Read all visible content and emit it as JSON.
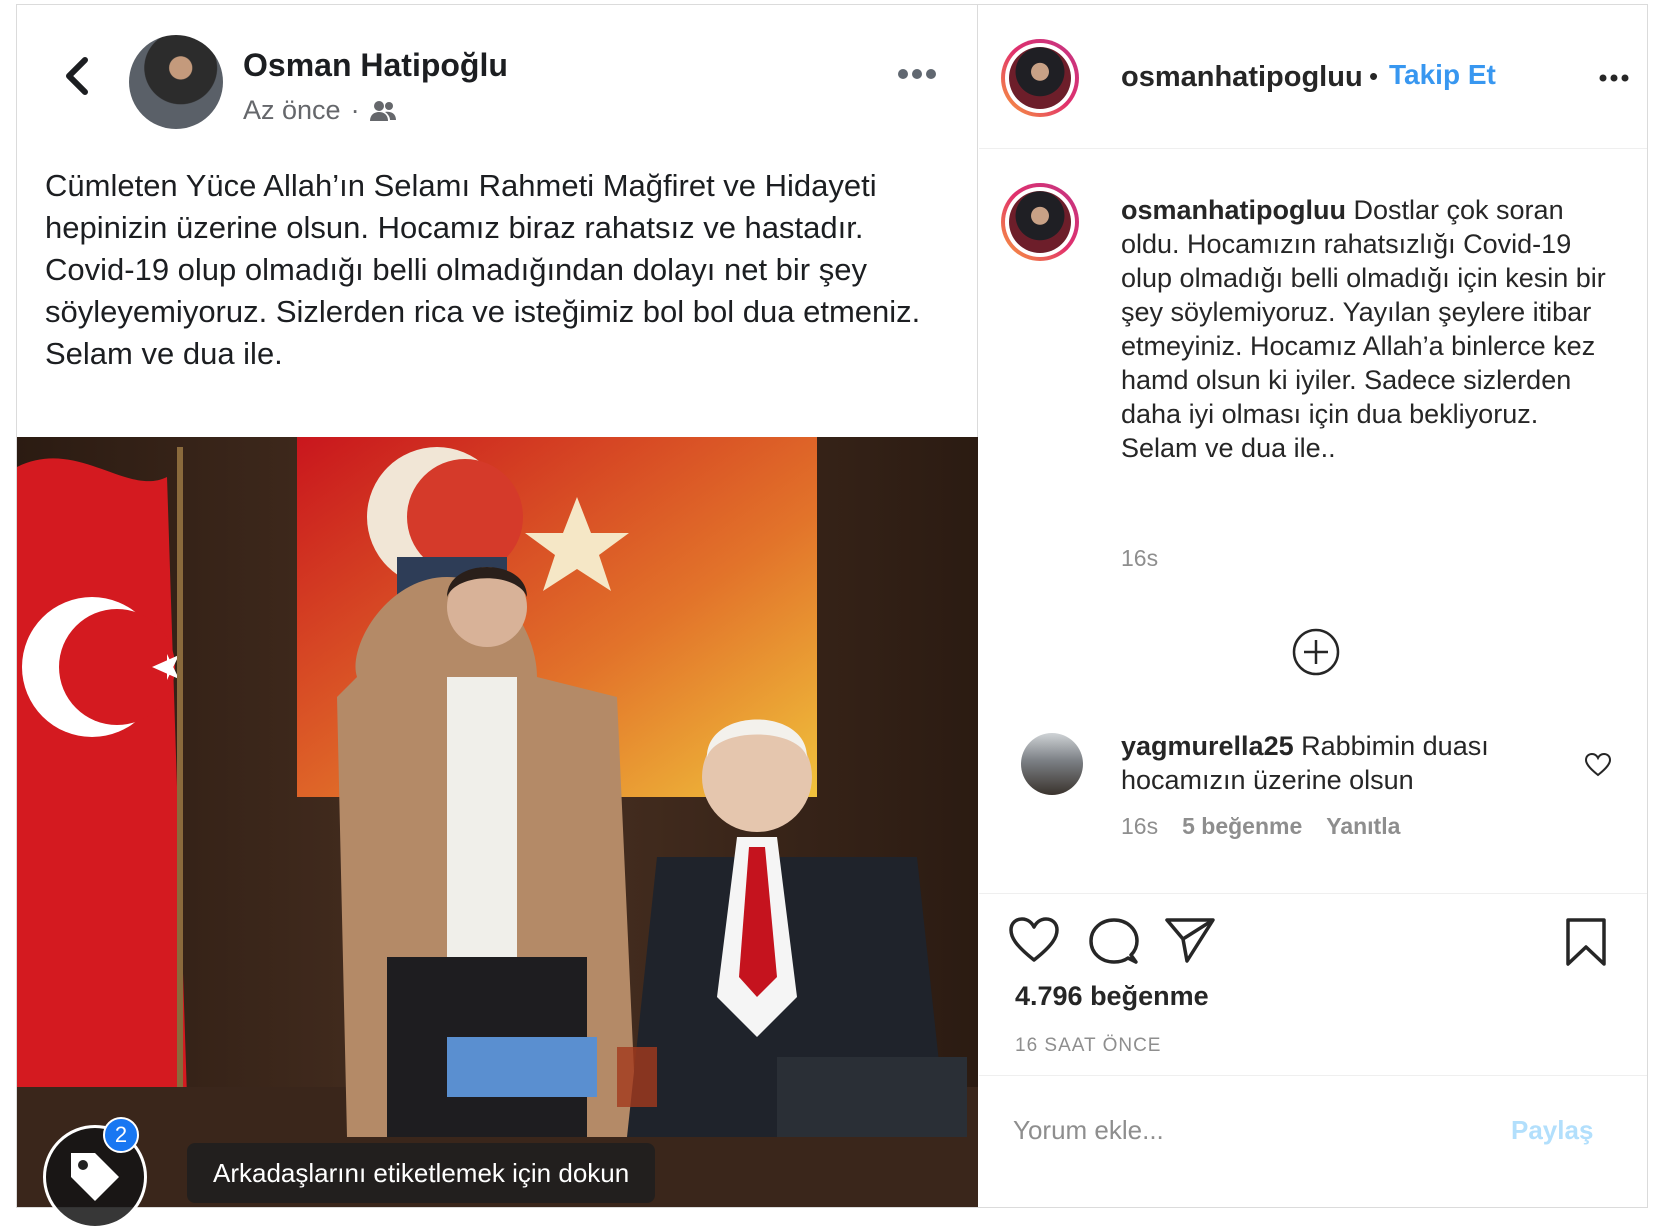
{
  "facebook": {
    "author": "Osman Hatipoğlu",
    "time": "Az önce",
    "separator": "·",
    "text": "Cümleten Yüce Allah’ın Selamı Rahmeti Mağfiret ve Hidayeti hepinizin üzerine olsun. Hocamız biraz rahatsız ve hastadır. Covid-19 olup olmadığı belli olmadığından dolayı net bir şey söyleyemiyoruz. Sizlerden rica ve isteğimiz bol bol dua etmeniz.\nSelam ve dua ile.",
    "tag_hint": "Arkadaşlarını etiketlemek için dokun",
    "tag_count": "2",
    "icons": [
      "back-chevron",
      "more-dots",
      "friends-audience",
      "tag-icon"
    ]
  },
  "instagram": {
    "username": "osmanhatipogluu",
    "dot": "•",
    "follow_label": "Takip Et",
    "caption_user": "osmanhatipogluu",
    "caption_text": " Dostlar çok soran oldu. Hocamızın rahatsızlığı Covid-19 olup olmadığı belli olmadığı için kesin bir şey söylemiyoruz. Yayılan şeylere itibar etmeyiniz. Hocamız Allah’a binlerce kez hamd olsun ki iyiler. Sadece sizlerden daha iyi olması için dua bekliyoruz.",
    "caption_closing": "Selam ve dua ile..",
    "caption_time": "16s",
    "comment": {
      "user": "yagmurella25",
      "text": " Rabbimin duası hocamızın üzerine olsun",
      "time": "16s",
      "likes": "5 beğenme",
      "reply": "Yanıtla"
    },
    "likes": "4.796 beğenme",
    "posted": "16 SAAT ÖNCE",
    "comment_placeholder": "Yorum ekle...",
    "share_label": "Paylaş",
    "colors": {
      "accent": "#3897f0",
      "share_disabled": "#b2dffc",
      "muted": "#8e8e8e"
    }
  }
}
